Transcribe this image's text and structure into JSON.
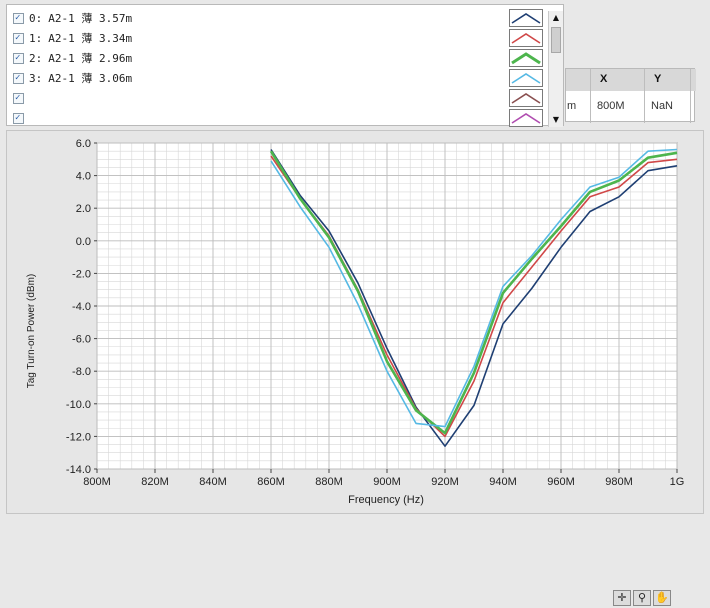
{
  "legend": {
    "rows": [
      {
        "index": "0:",
        "label": "A2-1 薄 3.57m",
        "color": "#1f3f73"
      },
      {
        "index": "1:",
        "label": "A2-1 薄  3.34m",
        "color": "#d04848"
      },
      {
        "index": "2:",
        "label": "A2-1 薄 2.96m",
        "color": "#4db54d"
      },
      {
        "index": "3:",
        "label": "A2-1 薄 3.06m",
        "color": "#56b9e4"
      },
      {
        "index": "",
        "label": "",
        "color": "#8a5050"
      },
      {
        "index": "",
        "label": "",
        "color": "#b04db0"
      }
    ]
  },
  "cursor": {
    "headers": {
      "x": "X",
      "y": "Y"
    },
    "row": {
      "name": "m",
      "x": "800M",
      "y": "NaN"
    }
  },
  "chart_data": {
    "type": "line",
    "xlabel": "Frequency (Hz)",
    "ylabel": "Tag Turn-on Power (dBm)",
    "xlim": [
      800,
      1000
    ],
    "ylim": [
      -14,
      6
    ],
    "x_tick_labels": [
      "800M",
      "820M",
      "840M",
      "860M",
      "880M",
      "900M",
      "920M",
      "940M",
      "960M",
      "980M",
      "1G"
    ],
    "y_tick_labels": [
      "6.0",
      "4.0",
      "2.0",
      "0.0",
      "-2.0",
      "-4.0",
      "-6.0",
      "-8.0",
      "-10.0",
      "-12.0",
      "-14.0"
    ],
    "grid": true,
    "x": [
      860,
      870,
      880,
      890,
      900,
      910,
      920,
      930,
      940,
      950,
      960,
      970,
      980,
      990,
      1000
    ],
    "series": [
      {
        "name": "0: A2-1 薄 3.57m",
        "color": "#1f3f73",
        "values": [
          5.6,
          2.8,
          0.6,
          -2.6,
          -6.6,
          -10.2,
          -12.6,
          -10.1,
          -5.1,
          -2.9,
          -0.4,
          1.8,
          2.7,
          4.3,
          4.6
        ]
      },
      {
        "name": "1: A2-1 薄  3.34m",
        "color": "#d04848",
        "values": [
          5.2,
          2.6,
          0.3,
          -3.0,
          -7.0,
          -10.3,
          -12.0,
          -8.6,
          -3.8,
          -1.6,
          0.6,
          2.7,
          3.3,
          4.8,
          5.0
        ]
      },
      {
        "name": "2: A2-1 薄 2.96m",
        "color": "#4db54d",
        "values": [
          5.5,
          2.6,
          0.2,
          -3.1,
          -7.4,
          -10.4,
          -11.8,
          -8.1,
          -3.2,
          -1.1,
          0.9,
          3.0,
          3.7,
          5.1,
          5.4
        ]
      },
      {
        "name": "3: A2-1 薄 3.06m",
        "color": "#56b9e4",
        "values": [
          4.9,
          2.1,
          -0.4,
          -3.9,
          -8.0,
          -11.2,
          -11.4,
          -7.7,
          -2.8,
          -0.9,
          1.3,
          3.3,
          3.9,
          5.5,
          5.6
        ]
      }
    ]
  },
  "tools": {
    "icons": [
      "crosshair-cursor-icon",
      "zoom-magnifier-icon",
      "pan-hand-icon"
    ]
  }
}
